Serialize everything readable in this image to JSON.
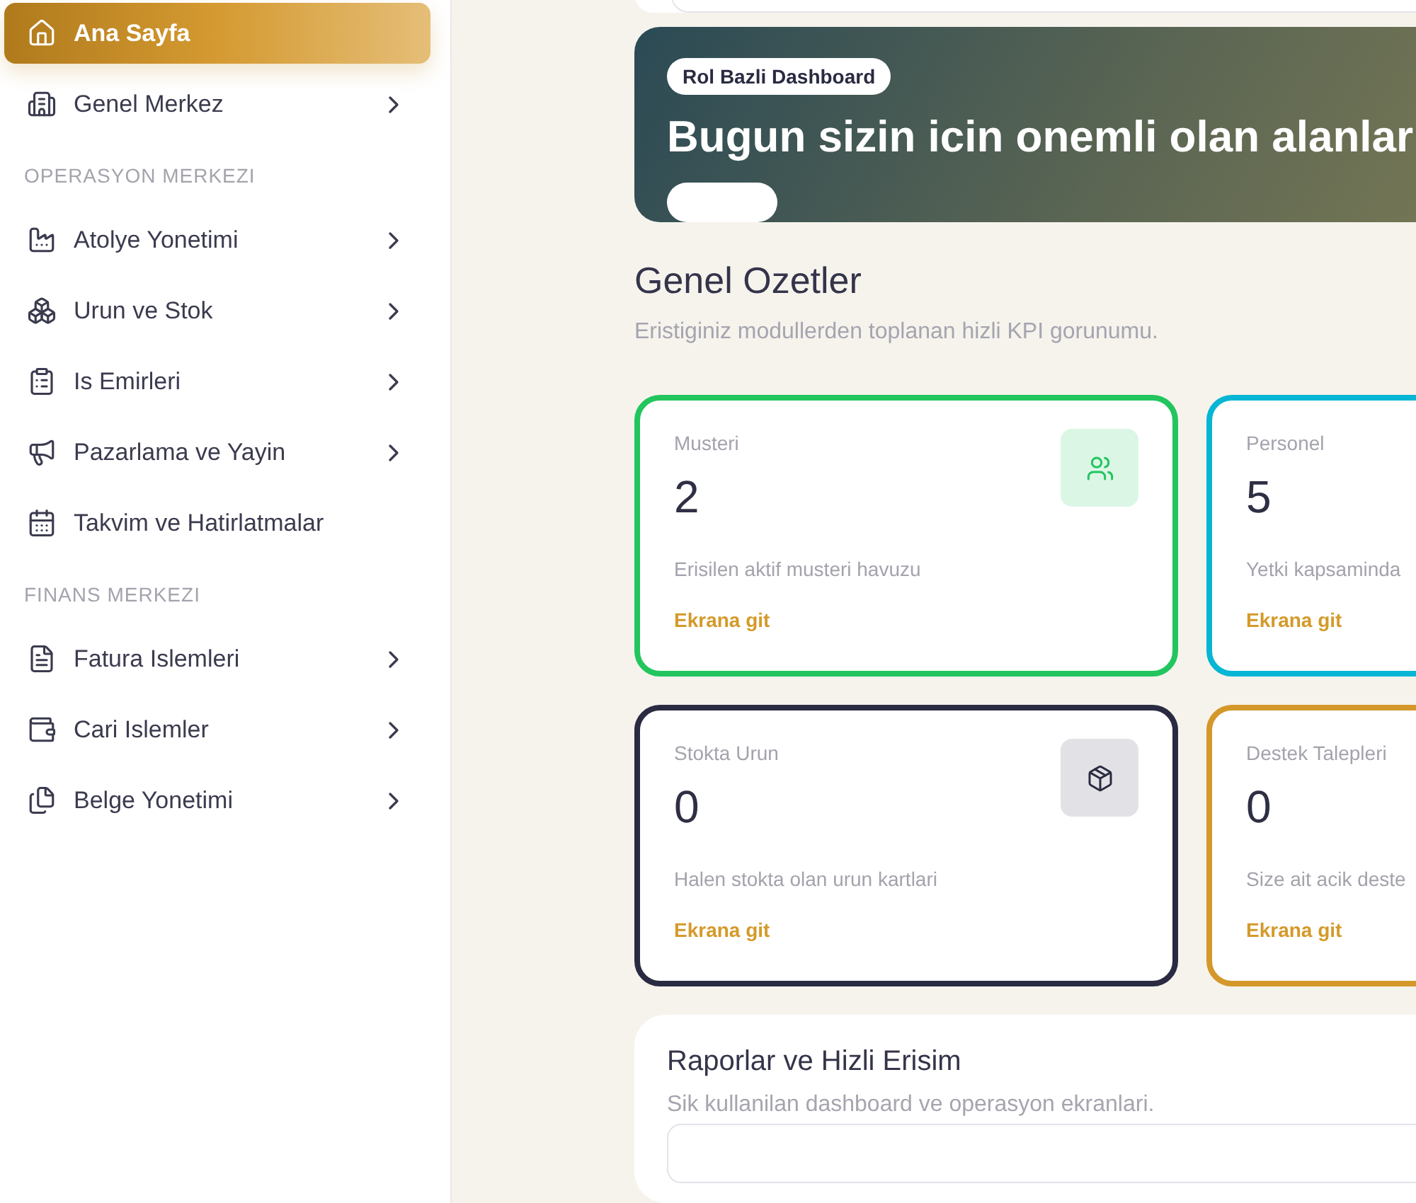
{
  "sidebar": {
    "sections": [
      {
        "items": [
          {
            "label": "Ana Sayfa",
            "selected": true,
            "expandable": false
          },
          {
            "label": "Genel Merkez",
            "selected": false,
            "expandable": true
          }
        ]
      },
      {
        "heading": "OPERASYON MERKEZI",
        "items": [
          {
            "label": "Atolye Yonetimi",
            "selected": false,
            "expandable": true
          },
          {
            "label": "Urun ve Stok",
            "selected": false,
            "expandable": true
          },
          {
            "label": "Is Emirleri",
            "selected": false,
            "expandable": true
          },
          {
            "label": "Pazarlama ve Yayin",
            "selected": false,
            "expandable": true
          },
          {
            "label": "Takvim ve Hatirlatmalar",
            "selected": false,
            "expandable": false
          }
        ]
      },
      {
        "heading": "FINANS MERKEZI",
        "items": [
          {
            "label": "Fatura Islemleri",
            "selected": false,
            "expandable": true
          },
          {
            "label": "Cari Islemler",
            "selected": false,
            "expandable": true
          },
          {
            "label": "Belge Yonetimi",
            "selected": false,
            "expandable": true
          }
        ]
      }
    ]
  },
  "banner": {
    "badge": "Rol Bazli Dashboard",
    "title": "Bugun sizin icin onemli olan alanlar"
  },
  "summary": {
    "title": "Genel Ozetler",
    "subtitle": "Eristiginiz modullerden toplanan hizli KPI gorunumu.",
    "cards": [
      {
        "label": "Musteri",
        "value": "2",
        "description": "Erisilen aktif musteri havuzu",
        "link": "Ekrana git",
        "color": "#22c55e",
        "kind": "users"
      },
      {
        "label": "Personel",
        "value": "5",
        "description": "Yetki kapsaminda",
        "link": "Ekrana git",
        "color": "#06b6d4"
      },
      {
        "label": "Stokta Urun",
        "value": "0",
        "description": "Halen stokta olan urun kartlari",
        "link": "Ekrana git",
        "color": "#2a2b42",
        "kind": "package"
      },
      {
        "label": "Destek Talepleri",
        "value": "0",
        "description": "Size ait acik deste",
        "link": "Ekrana git",
        "color": "#d4982a"
      }
    ]
  },
  "reports": {
    "title": "Raporlar ve Hizli Erisim",
    "subtitle": "Sik kullanilan dashboard ve operasyon ekranlari."
  }
}
